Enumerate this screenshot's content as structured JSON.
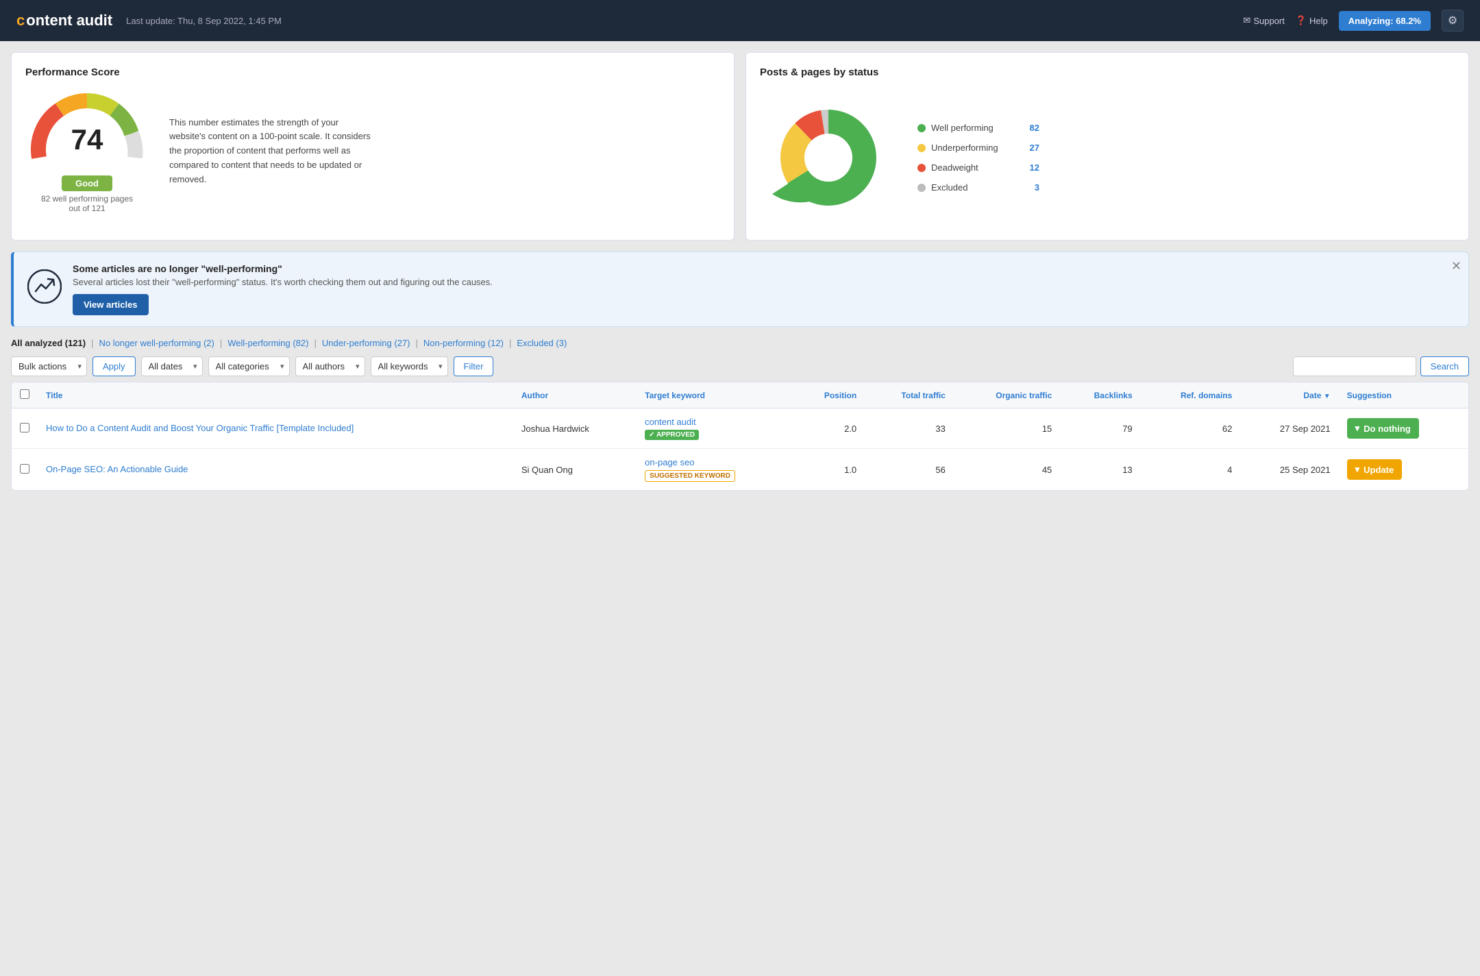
{
  "header": {
    "logo_text": "content audit",
    "logo_c": "c",
    "last_update": "Last update: Thu, 8 Sep 2022, 1:45 PM",
    "support_label": "Support",
    "help_label": "Help",
    "analyzing_label": "Analyzing: 68.2%"
  },
  "performance_card": {
    "title": "Performance Score",
    "score": "74",
    "badge": "Good",
    "subtitle": "82 well performing pages\nout of 121",
    "description": "This number estimates the strength of your website's content on a 100-point scale. It considers the proportion of content that performs well as compared to content that needs to be updated or removed."
  },
  "posts_card": {
    "title": "Posts & pages by status",
    "legend": [
      {
        "label": "Well performing",
        "count": "82",
        "color": "#4caf50"
      },
      {
        "label": "Underperforming",
        "count": "27",
        "color": "#f5c842"
      },
      {
        "label": "Deadweight",
        "count": "12",
        "color": "#e8513a"
      },
      {
        "label": "Excluded",
        "count": "3",
        "color": "#bbb"
      }
    ]
  },
  "alert": {
    "title": "Some articles are no longer \"well-performing\"",
    "description": "Several articles lost their \"well-performing\" status. It's worth checking them out and figuring out the causes.",
    "btn_label": "View articles"
  },
  "filter_tabs": [
    {
      "label": "All analyzed",
      "count": "121",
      "current": true
    },
    {
      "label": "No longer well-performing",
      "count": "2",
      "current": false
    },
    {
      "label": "Well-performing",
      "count": "82",
      "current": false
    },
    {
      "label": "Under-performing",
      "count": "27",
      "current": false
    },
    {
      "label": "Non-performing",
      "count": "12",
      "current": false
    },
    {
      "label": "Excluded",
      "count": "3",
      "current": false
    }
  ],
  "controls": {
    "bulk_actions_label": "Bulk actions",
    "apply_label": "Apply",
    "all_dates_label": "All dates",
    "all_categories_label": "All categories",
    "all_authors_label": "All authors",
    "all_keywords_label": "All keywords",
    "filter_label": "Filter",
    "search_label": "Search",
    "search_placeholder": ""
  },
  "table": {
    "columns": [
      "",
      "Title",
      "Author",
      "Target keyword",
      "Position",
      "Total traffic",
      "Organic traffic",
      "Backlinks",
      "Ref. domains",
      "Date",
      "Suggestion"
    ],
    "rows": [
      {
        "title": "How to Do a Content Audit and Boost Your Organic Traffic [Template Included]",
        "author": "Joshua Hardwick",
        "keyword": "content audit",
        "keyword_badge": "APPROVED",
        "keyword_badge_type": "approved",
        "position": "2.0",
        "total_traffic": "33",
        "organic_traffic": "15",
        "backlinks": "79",
        "ref_domains": "62",
        "date": "27 Sep 2021",
        "suggestion": "Do nothing",
        "suggestion_type": "do-nothing"
      },
      {
        "title": "On-Page SEO: An Actionable Guide",
        "author": "Si Quan Ong",
        "keyword": "on-page seo",
        "keyword_badge": "SUGGESTED KEYWORD",
        "keyword_badge_type": "suggested",
        "position": "1.0",
        "total_traffic": "56",
        "organic_traffic": "45",
        "backlinks": "13",
        "ref_domains": "4",
        "date": "25 Sep 2021",
        "suggestion": "Update",
        "suggestion_type": "update"
      }
    ]
  }
}
